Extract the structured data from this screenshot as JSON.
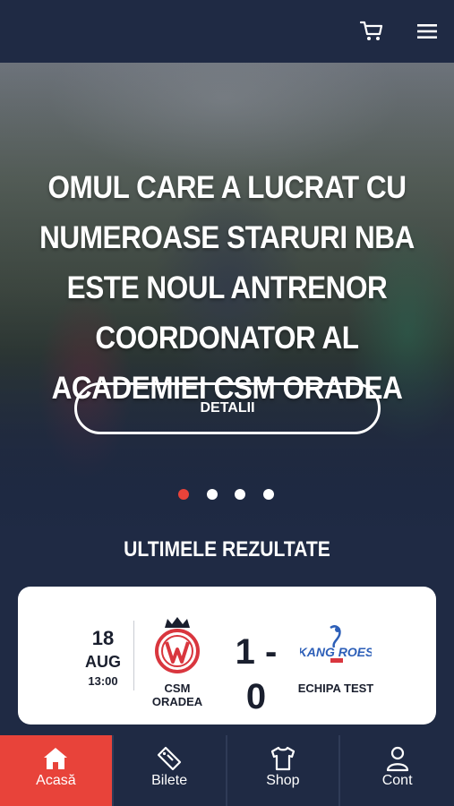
{
  "header": {
    "cart_icon": "cart-icon",
    "menu_icon": "hamburger-menu-icon"
  },
  "hero": {
    "title": "Omul care a lucrat cu numeroase staruri NBA este noul antrenor coordonator al Academiei CSM Oradea",
    "button_label": "DETALII",
    "slides_total": 4,
    "active_slide": 1
  },
  "results": {
    "section_title": "ULTIMELE REZULTATE",
    "match": {
      "day": "18",
      "month": "AUG",
      "time": "13:00",
      "home_team": "CSM ORADEA",
      "away_team": "ECHIPA TEST",
      "score": "1 - 0",
      "home_logo": "csm-oradea-logo",
      "away_logo": "kangaroes-logo"
    }
  },
  "tabbar": {
    "items": [
      {
        "label": "Acasă",
        "icon": "home-icon",
        "active": true
      },
      {
        "label": "Bilete",
        "icon": "ticket-icon",
        "active": false
      },
      {
        "label": "Shop",
        "icon": "tshirt-icon",
        "active": false
      },
      {
        "label": "Cont",
        "icon": "user-icon",
        "active": false
      }
    ]
  },
  "colors": {
    "background": "#1f2a44",
    "accent": "#e8433a",
    "card": "#ffffff"
  }
}
